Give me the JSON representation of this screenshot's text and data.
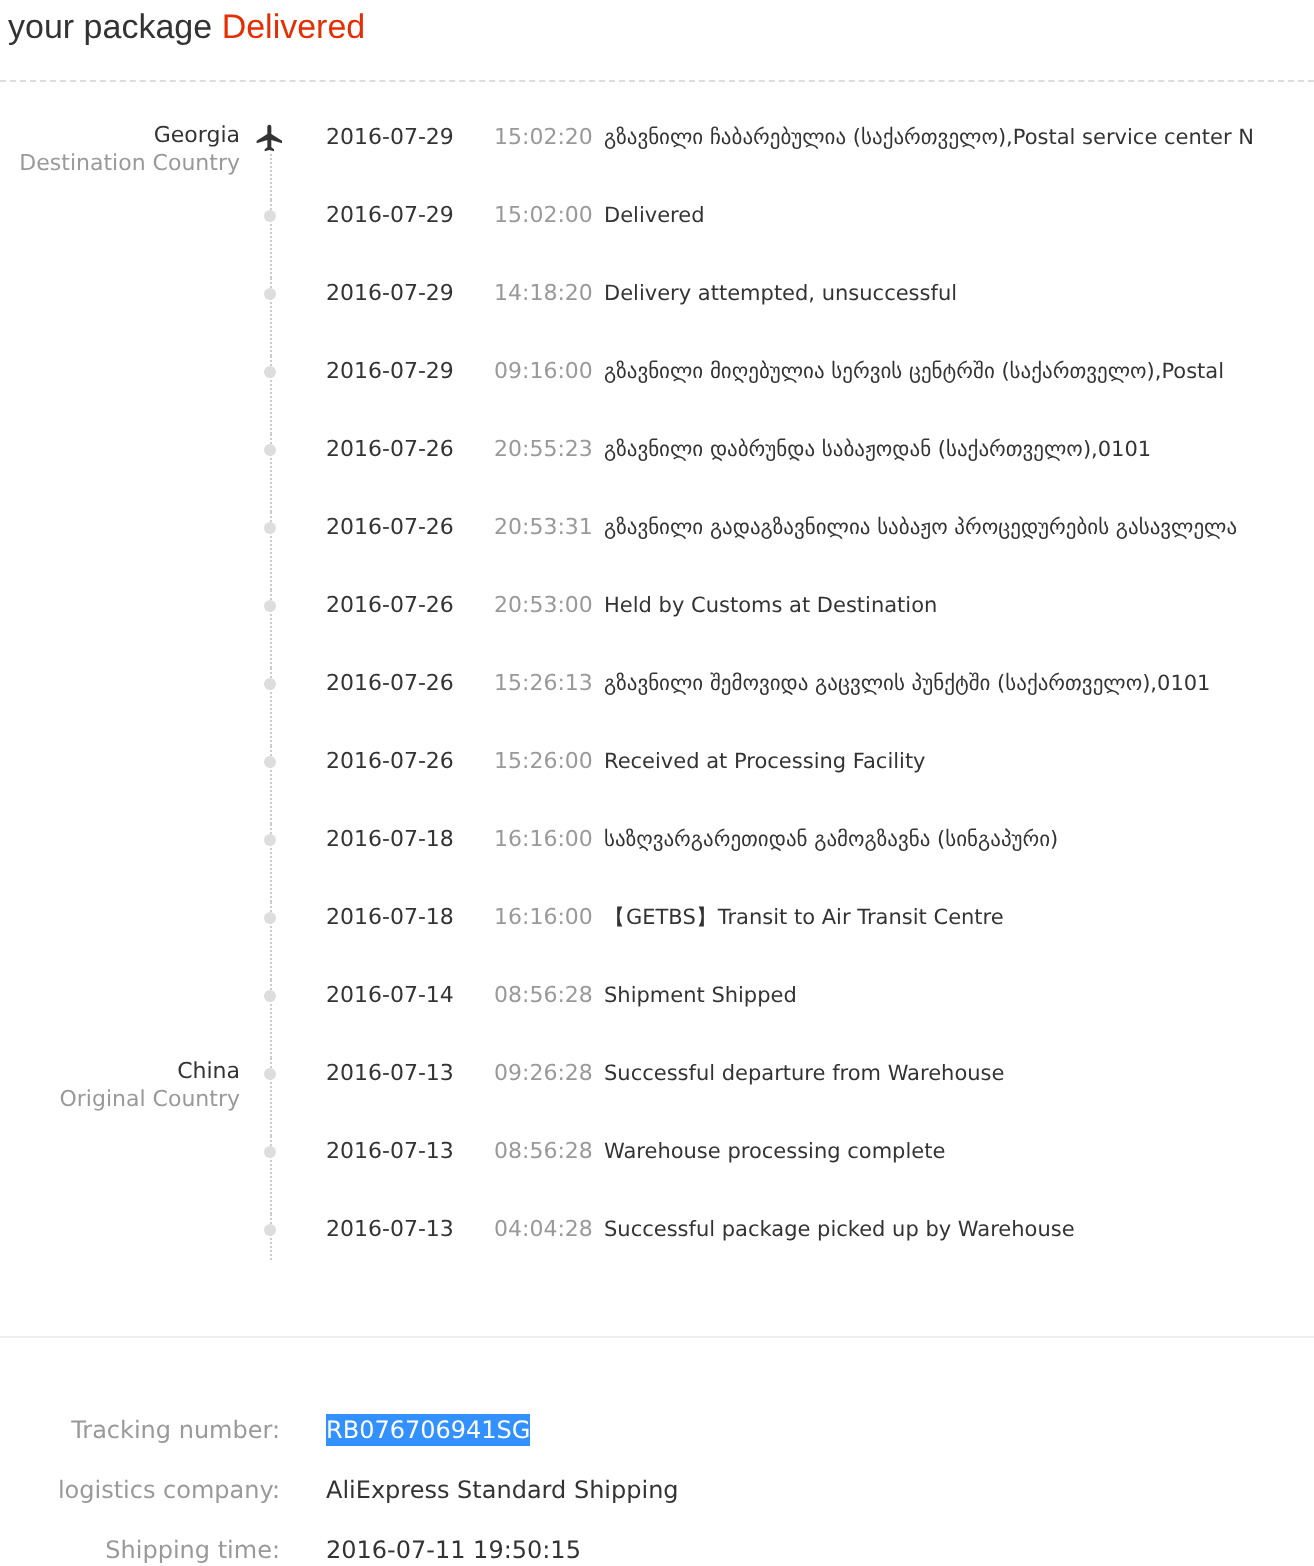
{
  "header": {
    "title": "your package",
    "status": "Delivered"
  },
  "events": [
    {
      "kind": "plane",
      "location": {
        "name": "Georgia",
        "role": "Destination Country"
      },
      "date": "2016-07-29",
      "time": "15:02:20",
      "description": "გზავნილი ჩაბარებულია (საქართველო),Postal service center N"
    },
    {
      "kind": "dot",
      "date": "2016-07-29",
      "time": "15:02:00",
      "description": "Delivered"
    },
    {
      "kind": "dot",
      "date": "2016-07-29",
      "time": "14:18:20",
      "description": "Delivery attempted, unsuccessful"
    },
    {
      "kind": "dot",
      "date": "2016-07-29",
      "time": "09:16:00",
      "description": "გზავნილი მიღებულია სერვის ცენტრში (საქართველო),Postal"
    },
    {
      "kind": "dot",
      "date": "2016-07-26",
      "time": "20:55:23",
      "description": "გზავნილი დაბრუნდა საბაჟოდან (საქართველო),0101"
    },
    {
      "kind": "dot",
      "date": "2016-07-26",
      "time": "20:53:31",
      "description": "გზავნილი გადაგზავნილია საბაჟო პროცედურების გასავლელა"
    },
    {
      "kind": "dot",
      "date": "2016-07-26",
      "time": "20:53:00",
      "description": "Held by Customs at Destination"
    },
    {
      "kind": "dot",
      "date": "2016-07-26",
      "time": "15:26:13",
      "description": "გზავნილი შემოვიდა გაცვლის პუნქტში (საქართველო),0101"
    },
    {
      "kind": "dot",
      "date": "2016-07-26",
      "time": "15:26:00",
      "description": "Received at Processing Facility"
    },
    {
      "kind": "dot",
      "date": "2016-07-18",
      "time": "16:16:00",
      "description": "საზღვარგარეთიდან გამოგზავნა (სინგაპური)"
    },
    {
      "kind": "dot",
      "date": "2016-07-18",
      "time": "16:16:00",
      "description": "【GETBS】Transit to Air Transit Centre"
    },
    {
      "kind": "dot",
      "date": "2016-07-14",
      "time": "08:56:28",
      "description": "Shipment Shipped"
    },
    {
      "kind": "dot",
      "location": {
        "name": "China",
        "role": "Original Country"
      },
      "date": "2016-07-13",
      "time": "09:26:28",
      "description": "Successful departure from Warehouse"
    },
    {
      "kind": "dot",
      "date": "2016-07-13",
      "time": "08:56:28",
      "description": "Warehouse processing complete"
    },
    {
      "kind": "dot",
      "date": "2016-07-13",
      "time": "04:04:28",
      "description": "Successful package picked up by Warehouse"
    }
  ],
  "details": [
    {
      "label": "Tracking number:",
      "value": "RB076706941SG",
      "selected": true
    },
    {
      "label": "logistics company:",
      "value": "AliExpress Standard Shipping",
      "selected": false
    },
    {
      "label": "Shipping time:",
      "value": "2016-07-11 19:50:15",
      "selected": false
    }
  ]
}
